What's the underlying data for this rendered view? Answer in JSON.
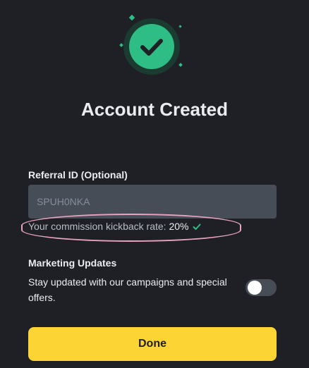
{
  "header": {
    "title": "Account Created",
    "success_icon": "check-circle-icon"
  },
  "referral": {
    "label": "Referral ID (Optional)",
    "value": "SPUH0NKA",
    "kickback_prefix": "Your commission kickback rate: ",
    "kickback_rate": "20%",
    "kickback_icon": "checkmark-icon"
  },
  "marketing": {
    "label": "Marketing Updates",
    "description": "Stay updated with our campaigns and special offers.",
    "toggle_on": false
  },
  "actions": {
    "done_label": "Done"
  },
  "colors": {
    "background": "#1e2026",
    "success": "#2ebd85",
    "primary_button": "#fcd535",
    "input_bg": "#474d57",
    "annotation": "#e8a3c0"
  }
}
